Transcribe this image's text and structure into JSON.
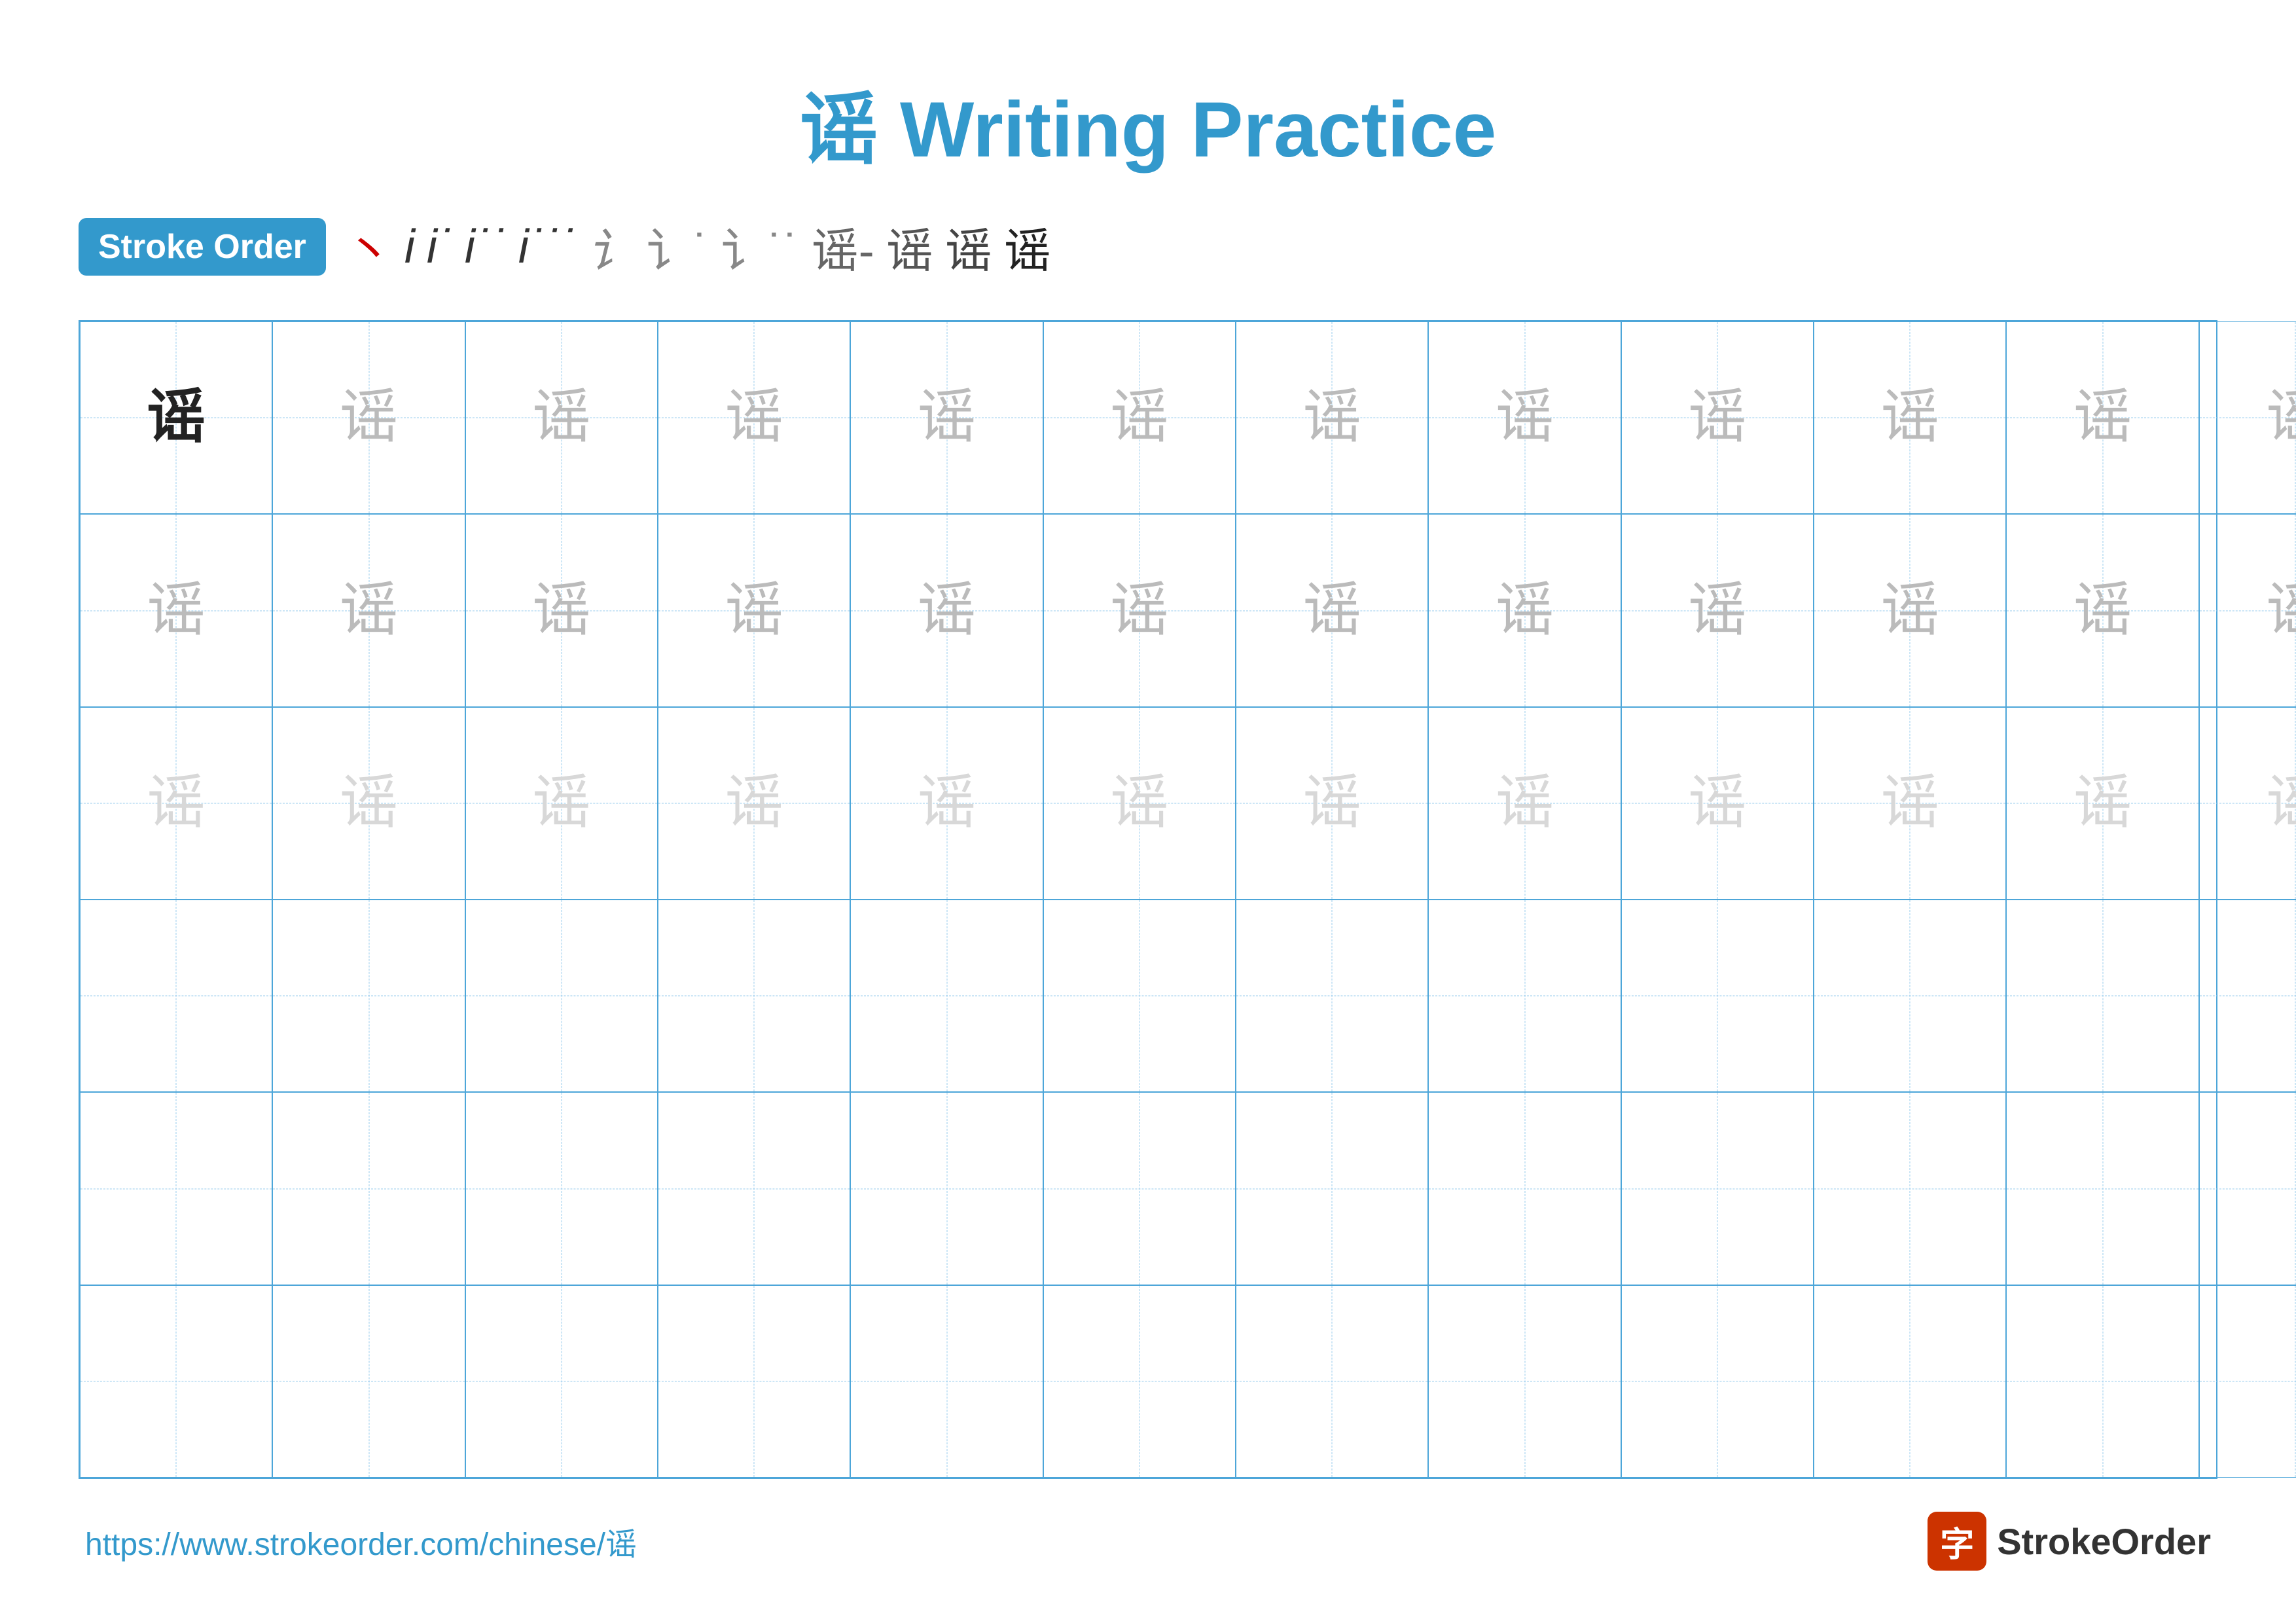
{
  "page": {
    "title": "谣 Writing Practice",
    "stroke_order_label": "Stroke Order",
    "stroke_steps": [
      "丶",
      "i",
      "i˙",
      "i˙˙",
      "i˙˙˙",
      "i˙˙˙˙",
      "i˙˙˙˙˙",
      "i˙˙˙˙˙˙",
      "谣-8",
      "谣-9",
      "谣-10",
      "谣-11"
    ],
    "character": "谣",
    "footer_url": "https://www.strokeorder.com/chinese/谣",
    "footer_logo_char": "字",
    "footer_logo_name": "StrokeOrder"
  },
  "grid": {
    "cols": 13,
    "rows": 6,
    "row_types": [
      "solid-then-medium",
      "medium",
      "light",
      "empty",
      "empty",
      "empty"
    ]
  }
}
